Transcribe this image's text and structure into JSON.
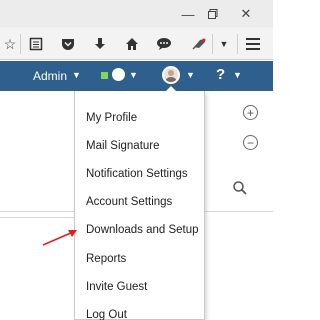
{
  "titlebar": {
    "icons": [
      "minimize-icon",
      "restore-icon",
      "close-icon"
    ]
  },
  "toolbar": {
    "icons": [
      "star-icon",
      "reader-icon",
      "pocket-icon",
      "download-icon",
      "home-icon",
      "chat-icon",
      "extension-icon",
      "dropdown-icon",
      "menu-icon"
    ]
  },
  "appbar": {
    "admin_label": "Admin",
    "status_color": "#7ed957",
    "help_label": "?",
    "background": "#2f5f8d"
  },
  "profile_menu": {
    "items": [
      "My Profile",
      "Mail Signature",
      "Notification Settings",
      "Account Settings",
      "Downloads and Setup",
      "Reports",
      "Invite Guest",
      "Log Out"
    ]
  },
  "annotation": {
    "arrow_color": "#e02020"
  }
}
